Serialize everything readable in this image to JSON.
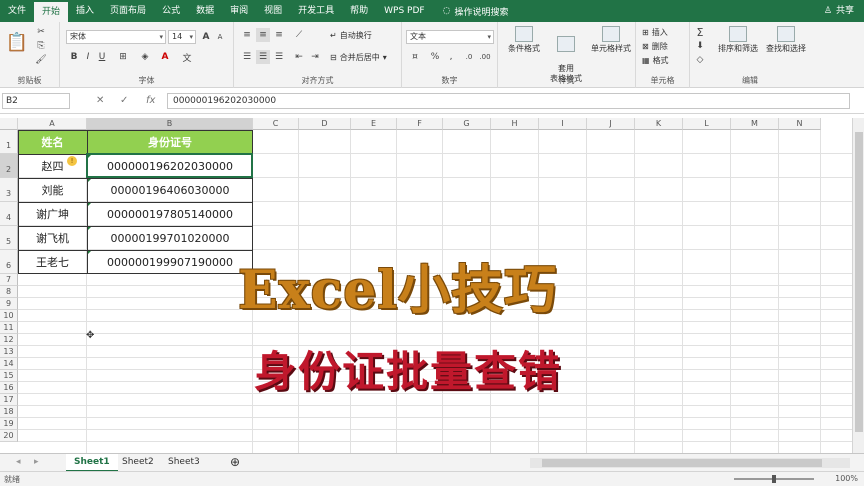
{
  "menu": {
    "tabs": [
      "文件",
      "开始",
      "插入",
      "页面布局",
      "公式",
      "数据",
      "审阅",
      "视图",
      "开发工具",
      "帮助",
      "WPS PDF"
    ],
    "active_index": 1,
    "tell_me": "操作说明搜索",
    "share": "共享"
  },
  "ribbon": {
    "clipboard": {
      "label": "剪贴板"
    },
    "font": {
      "label": "字体",
      "font_name": "宋体",
      "font_size": "14",
      "bold": "B",
      "italic": "I",
      "underline": "U",
      "grow": "A",
      "shrink": "A"
    },
    "alignment": {
      "label": "对齐方式",
      "wrap": "自动换行",
      "merge": "合并后居中"
    },
    "number": {
      "label": "数字",
      "format": "文本",
      "percent": "%",
      "comma": ","
    },
    "styles": {
      "label": "样式",
      "cond": "条件格式",
      "table": "套用\n表格格式",
      "cell": "单元格样式"
    },
    "cells": {
      "label": "单元格",
      "insert": "插入",
      "delete": "删除",
      "format": "格式"
    },
    "editing": {
      "label": "编辑",
      "sort": "排序和筛选",
      "find": "查找和选择"
    }
  },
  "formula_bar": {
    "name_box": "B2",
    "fx": "fx",
    "value": "000000196202030000"
  },
  "columns": [
    "A",
    "B",
    "C",
    "D",
    "E",
    "F",
    "G",
    "H",
    "I",
    "J",
    "K",
    "L",
    "M",
    "N"
  ],
  "rows": [
    "1",
    "2",
    "3",
    "4",
    "5",
    "6",
    "7",
    "8",
    "9",
    "10",
    "11",
    "12",
    "13",
    "14",
    "15",
    "16",
    "17",
    "18",
    "19",
    "20"
  ],
  "table": {
    "headers": [
      "姓名",
      "身份证号"
    ],
    "records": [
      [
        "赵四",
        "000000196202030000"
      ],
      [
        "刘能",
        "00000196406030000"
      ],
      [
        "谢广坤",
        "000000197805140000"
      ],
      [
        "谢飞机",
        "00000199701020000"
      ],
      [
        "王老七",
        "000000199907190000"
      ]
    ]
  },
  "overlay": {
    "title": "Excel小技巧",
    "subtitle": "身份证批量查错"
  },
  "sheets": {
    "tabs": [
      "Sheet1",
      "Sheet2",
      "Sheet3"
    ],
    "active_index": 0,
    "add": "⊕"
  },
  "status": {
    "ready": "就绪",
    "zoom": "100%"
  },
  "colors": {
    "brand": "#217346",
    "header_fill": "#92d050",
    "title": "#c8801a",
    "subtitle": "#c0182c"
  }
}
